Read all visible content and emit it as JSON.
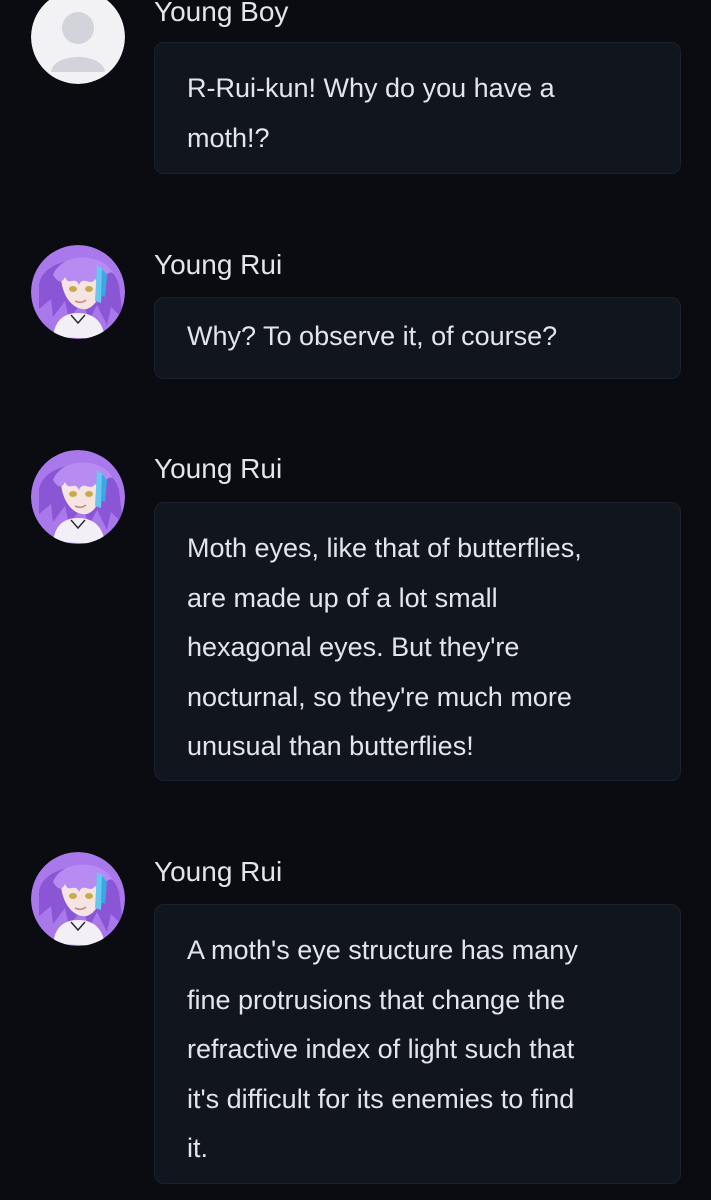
{
  "colors": {
    "background": "#0a0c11",
    "bubble_background": "#11151e",
    "text": "#e3e5ea",
    "avatar_theme": "#a978ea"
  },
  "messages": [
    {
      "sender": "Young Boy",
      "avatar_icon": "default-user-icon",
      "text": "R-Rui-kun! Why do you have a\nmoth!?"
    },
    {
      "sender": "Young Rui",
      "avatar_icon": "character-portrait",
      "text": "Why? To observe it, of course?"
    },
    {
      "sender": "Young Rui",
      "avatar_icon": "character-portrait",
      "text": "Moth eyes, like that of butterflies,\nare made up of a lot small\nhexagonal eyes. But they're\nnocturnal, so they're much more\nunusual than butterflies!"
    },
    {
      "sender": "Young Rui",
      "avatar_icon": "character-portrait",
      "text": "A moth's eye structure has many\nfine protrusions that change the\nrefractive index of light such that\nit's difficult for its enemies to find\nit."
    }
  ]
}
